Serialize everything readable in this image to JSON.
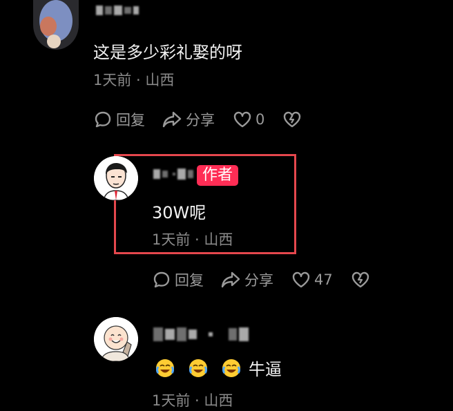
{
  "comments": [
    {
      "text": "这是多少彩礼娶的呀",
      "meta": "1天前 · 山西",
      "actions": {
        "reply": "回复",
        "share": "分享",
        "likes": "0"
      }
    },
    {
      "badge": "作者",
      "text": "30W呢",
      "meta": "1天前 · 山西",
      "actions": {
        "reply": "回复",
        "share": "分享",
        "likes": "47"
      }
    },
    {
      "text": "牛逼",
      "meta": "1天前 · 山西",
      "emojis": [
        "crying-laughing-emoji",
        "crying-laughing-emoji",
        "crying-laughing-emoji"
      ]
    }
  ],
  "colors": {
    "background": "#000000",
    "badge": "#ff2d55",
    "highlight": "#e5474d",
    "muted": "#8a8a8a"
  }
}
